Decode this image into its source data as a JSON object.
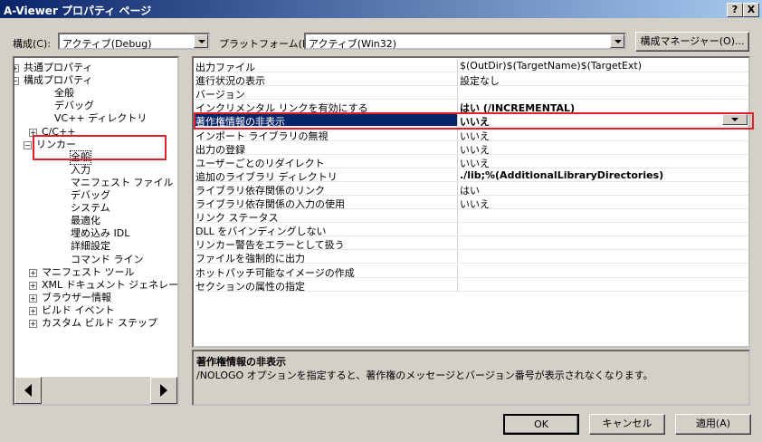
{
  "window": {
    "title": "A-Viewer プロパティ ページ",
    "help_btn": "?",
    "close_btn": "X"
  },
  "top": {
    "config_label": "構成(C):",
    "config_value": "アクティブ(Debug)",
    "platform_label": "プラットフォーム(P):",
    "platform_value": "アクティブ(Win32)",
    "config_manager": "構成マネージャー(O)..."
  },
  "tree": {
    "items": [
      {
        "label": "共通プロパティ",
        "exp": "+"
      },
      {
        "label": "構成プロパティ",
        "exp": "−"
      },
      {
        "label": "全般"
      },
      {
        "label": "デバッグ"
      },
      {
        "label": "VC++ ディレクトリ"
      },
      {
        "label": "C/C++",
        "exp": "+"
      },
      {
        "label": "リンカー",
        "exp": "−"
      },
      {
        "label": "全般"
      },
      {
        "label": "入力"
      },
      {
        "label": "マニフェスト ファイル"
      },
      {
        "label": "デバッグ"
      },
      {
        "label": "システム"
      },
      {
        "label": "最適化"
      },
      {
        "label": "埋め込み IDL"
      },
      {
        "label": "詳細設定"
      },
      {
        "label": "コマンド ライン"
      },
      {
        "label": "マニフェスト ツール",
        "exp": "+"
      },
      {
        "label": "XML ドキュメント ジェネレーター",
        "exp": "+"
      },
      {
        "label": "ブラウザー情報",
        "exp": "+"
      },
      {
        "label": "ビルド イベント",
        "exp": "+"
      },
      {
        "label": "カスタム ビルド ステップ",
        "exp": "+"
      }
    ]
  },
  "grid": {
    "rows": [
      {
        "name": "出力ファイル",
        "value": "$(OutDir)$(TargetName)$(TargetExt)"
      },
      {
        "name": "進行状況の表示",
        "value": "設定なし"
      },
      {
        "name": "バージョン",
        "value": ""
      },
      {
        "name": "インクリメンタル リンクを有効にする",
        "value": "はい (/INCREMENTAL)",
        "bold": true
      },
      {
        "name": "著作権情報の非表示",
        "value": "いいえ",
        "bold": true,
        "selected": true
      },
      {
        "name": "インポート ライブラリの無視",
        "value": "いいえ"
      },
      {
        "name": "出力の登録",
        "value": "いいえ"
      },
      {
        "name": "ユーザーごとのリダイレクト",
        "value": "いいえ"
      },
      {
        "name": "追加のライブラリ ディレクトリ",
        "value": "./lib;%(AdditionalLibraryDirectories)",
        "bold": true
      },
      {
        "name": "ライブラリ依存関係のリンク",
        "value": "はい"
      },
      {
        "name": "ライブラリ依存関係の入力の使用",
        "value": "いいえ"
      },
      {
        "name": "リンク ステータス",
        "value": ""
      },
      {
        "name": "DLL をバインディングしない",
        "value": ""
      },
      {
        "name": "リンカー警告をエラーとして扱う",
        "value": ""
      },
      {
        "name": "ファイルを強制的に出力",
        "value": ""
      },
      {
        "name": "ホットパッチ可能なイメージの作成",
        "value": ""
      },
      {
        "name": "セクションの属性の指定",
        "value": ""
      }
    ]
  },
  "description": {
    "title": "著作権情報の非表示",
    "text": "/NOLOGO オプションを指定すると、著作権のメッセージとバージョン番号が表示されなくなります。"
  },
  "buttons": {
    "ok": "OK",
    "cancel": "キャンセル",
    "apply": "適用(A)"
  },
  "colors": {
    "highlight": "#e0202a",
    "selection": "#0a246a"
  }
}
